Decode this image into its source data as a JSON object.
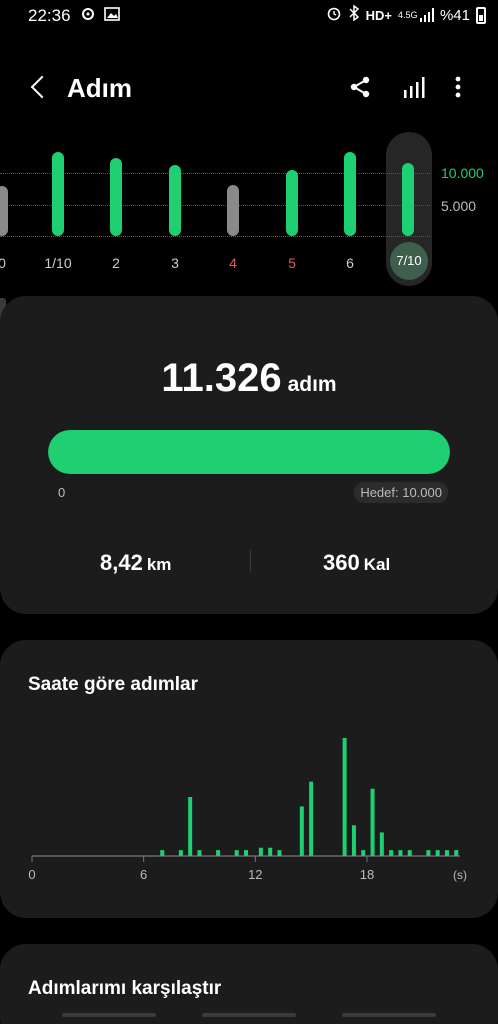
{
  "status_bar": {
    "time": "22:36",
    "network": "HD+",
    "network_small_top": "4.5G",
    "battery_pct": "%41",
    "icons": [
      "notification-icon",
      "gallery-icon",
      "alarm-icon",
      "bluetooth-icon",
      "signal-icon",
      "battery-icon"
    ]
  },
  "header": {
    "title": "Adım",
    "back_icon": "back-arrow-icon",
    "share_icon": "share-icon",
    "trends_icon": "bar-chart-icon",
    "more_icon": "more-vert-icon"
  },
  "week_chart": {
    "ref_lines": [
      "10.000",
      "5.000"
    ],
    "days": [
      {
        "label": "0",
        "value": 0.6,
        "color": "#8a8a8a"
      },
      {
        "label": "1/10",
        "value": 1.0,
        "color": "#1ed071"
      },
      {
        "label": "2",
        "value": 0.93,
        "color": "#1ed071"
      },
      {
        "label": "3",
        "value": 0.84,
        "color": "#1ed071"
      },
      {
        "label": "4",
        "value": 0.61,
        "color": "#8a8a8a",
        "label_color": "#e05a5a"
      },
      {
        "label": "5",
        "value": 0.78,
        "color": "#1ed071",
        "label_color": "#e05a5a"
      },
      {
        "label": "6",
        "value": 1.0,
        "color": "#1ed071"
      },
      {
        "label": "7/10",
        "value": 0.87,
        "color": "#1ed071",
        "selected": true
      }
    ]
  },
  "summary": {
    "steps": "11.326",
    "steps_unit": "adım",
    "progress_fraction": 1.0,
    "progress_min": "0",
    "goal": "Hedef: 10.000",
    "distance_value": "8,42",
    "distance_unit": "km",
    "calories_value": "360",
    "calories_unit": "Kal"
  },
  "hourly": {
    "title": "Saate göre adımlar",
    "x_ticks": [
      "0",
      "6",
      "12",
      "18"
    ],
    "x_unit": "(s)",
    "bars": [
      {
        "h": 7.0,
        "v": 0.05
      },
      {
        "h": 8.0,
        "v": 0.05
      },
      {
        "h": 8.5,
        "v": 0.5
      },
      {
        "h": 9.0,
        "v": 0.05
      },
      {
        "h": 10.0,
        "v": 0.05
      },
      {
        "h": 11.0,
        "v": 0.05
      },
      {
        "h": 11.5,
        "v": 0.05
      },
      {
        "h": 12.3,
        "v": 0.07
      },
      {
        "h": 12.8,
        "v": 0.07
      },
      {
        "h": 13.3,
        "v": 0.05
      },
      {
        "h": 14.5,
        "v": 0.42
      },
      {
        "h": 15.0,
        "v": 0.63
      },
      {
        "h": 16.8,
        "v": 1.0
      },
      {
        "h": 17.3,
        "v": 0.26
      },
      {
        "h": 17.8,
        "v": 0.05
      },
      {
        "h": 18.3,
        "v": 0.57
      },
      {
        "h": 18.8,
        "v": 0.2
      },
      {
        "h": 19.3,
        "v": 0.05
      },
      {
        "h": 19.8,
        "v": 0.05
      },
      {
        "h": 20.3,
        "v": 0.05
      },
      {
        "h": 21.3,
        "v": 0.05
      },
      {
        "h": 21.8,
        "v": 0.05
      },
      {
        "h": 22.3,
        "v": 0.05
      },
      {
        "h": 22.8,
        "v": 0.05
      }
    ]
  },
  "compare": {
    "title": "Adımlarımı karşılaştır"
  },
  "colors": {
    "accent": "#1ed071",
    "card_bg": "#1c1c1c",
    "inactive_bar": "#8a8a8a",
    "weekend_label": "#e05a5a"
  }
}
